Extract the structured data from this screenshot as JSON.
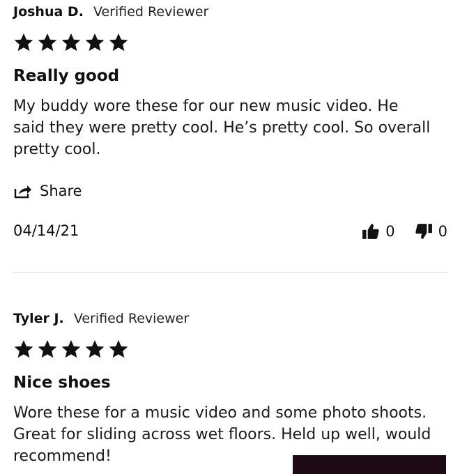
{
  "reviews": [
    {
      "author": "Joshua D.",
      "badge": "Verified Reviewer",
      "rating": 5,
      "title": "Really good",
      "body": "My buddy wore these for our new music video. He said they were pretty cool. He’s pretty cool. So overall pretty cool.",
      "share_label": "Share",
      "date": "04/14/21",
      "helpful_up": "0",
      "helpful_down": "0"
    },
    {
      "author": "Tyler J.",
      "badge": "Verified Reviewer",
      "rating": 5,
      "title": "Nice shoes",
      "body": "Wore these for a music video and some photo shoots. Great for sliding across wet floors. Held up well, would recommend!"
    }
  ],
  "icons": {
    "star": "star-icon",
    "share": "share-icon",
    "thumbs_up": "thumbs-up-icon",
    "thumbs_down": "thumbs-down-icon"
  },
  "colors": {
    "text": "#111111",
    "divider": "#d9d9d9",
    "panel": "#1d0a14"
  }
}
